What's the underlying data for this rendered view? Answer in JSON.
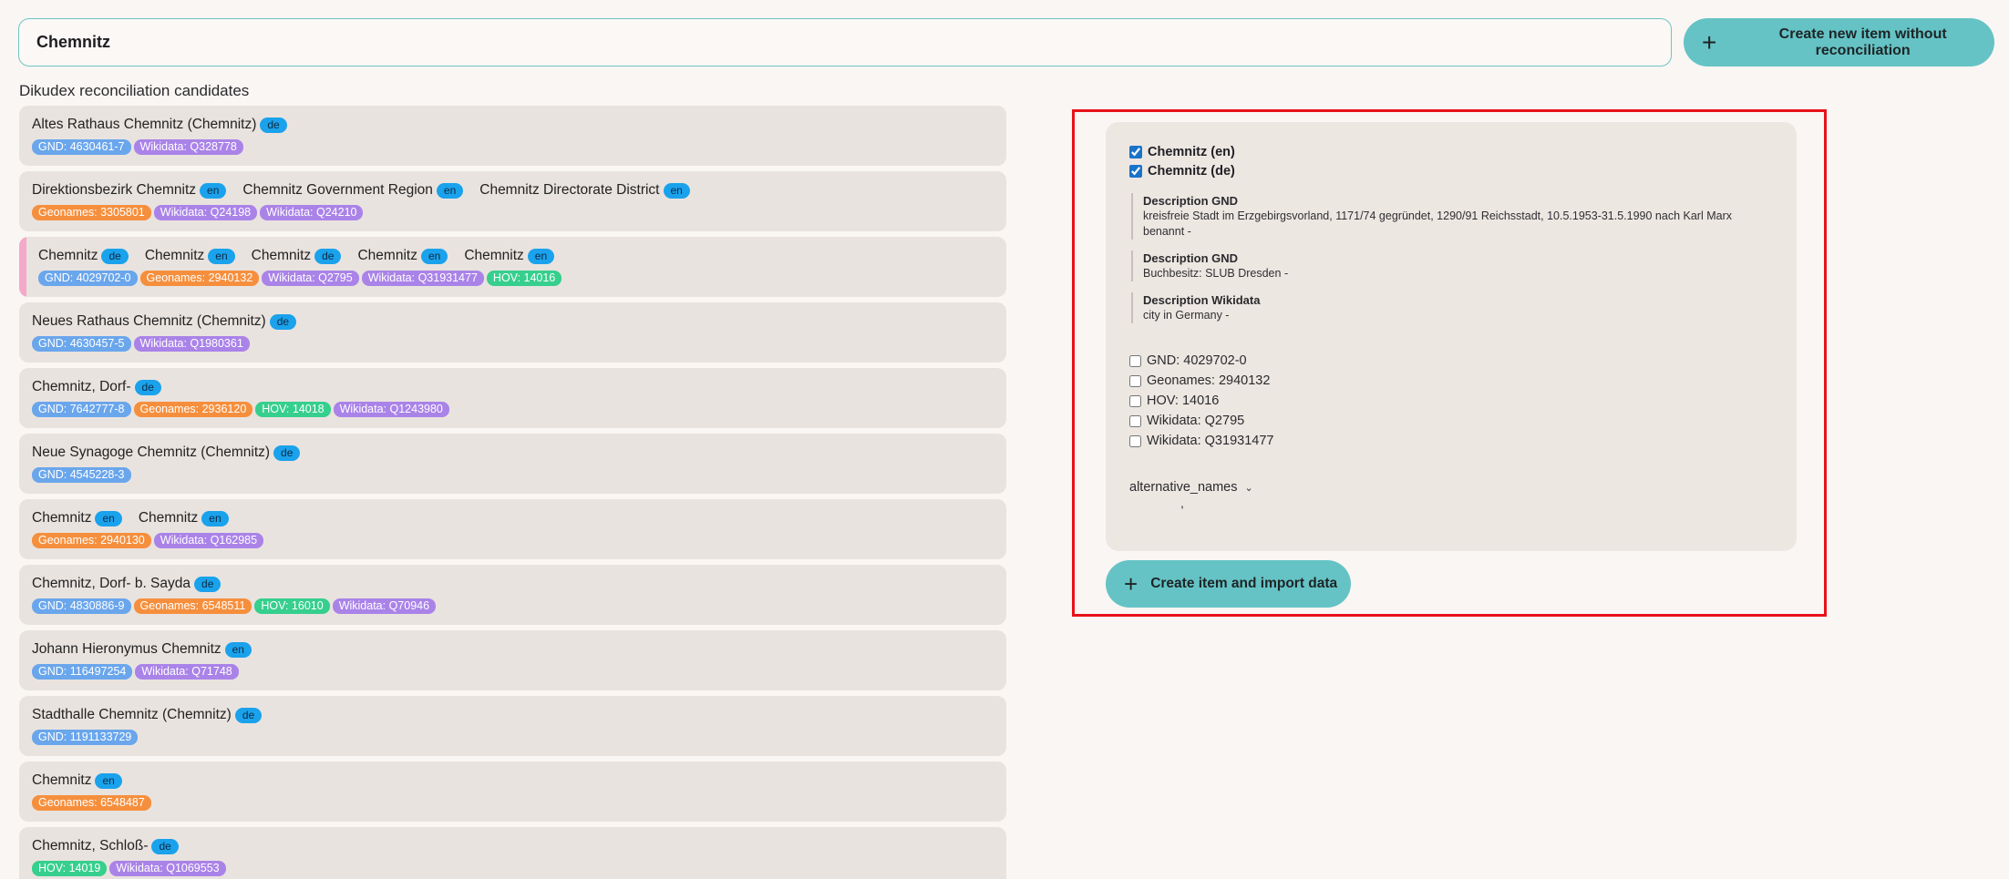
{
  "search": {
    "value": "Chemnitz"
  },
  "create_new_button": {
    "label": "Create new item without reconciliation",
    "icon": "plus-icon"
  },
  "candidates_title": "Dikudex reconciliation candidates",
  "candidates": [
    {
      "names": [
        {
          "text": "Altes Rathaus Chemnitz (Chemnitz)",
          "lang": "de"
        }
      ],
      "ids": [
        {
          "type": "gnd",
          "label": "GND: 4630461-7"
        },
        {
          "type": "wikidata",
          "label": "Wikidata: Q328778"
        }
      ]
    },
    {
      "names": [
        {
          "text": "Direktionsbezirk Chemnitz",
          "lang": "en"
        },
        {
          "text": "Chemnitz Government Region",
          "lang": "en"
        },
        {
          "text": "Chemnitz Directorate District",
          "lang": "en"
        }
      ],
      "ids": [
        {
          "type": "geonames",
          "label": "Geonames: 3305801"
        },
        {
          "type": "wikidata",
          "label": "Wikidata: Q24198"
        },
        {
          "type": "wikidata",
          "label": "Wikidata: Q24210"
        }
      ]
    },
    {
      "selected": true,
      "names": [
        {
          "text": "Chemnitz",
          "lang": "de"
        },
        {
          "text": "Chemnitz",
          "lang": "en"
        },
        {
          "text": "Chemnitz",
          "lang": "de"
        },
        {
          "text": "Chemnitz",
          "lang": "en"
        },
        {
          "text": "Chemnitz",
          "lang": "en"
        }
      ],
      "ids": [
        {
          "type": "gnd",
          "label": "GND: 4029702-0"
        },
        {
          "type": "geonames",
          "label": "Geonames: 2940132"
        },
        {
          "type": "wikidata",
          "label": "Wikidata: Q2795"
        },
        {
          "type": "wikidata",
          "label": "Wikidata: Q31931477"
        },
        {
          "type": "hov",
          "label": "HOV: 14016"
        }
      ]
    },
    {
      "names": [
        {
          "text": "Neues Rathaus Chemnitz (Chemnitz)",
          "lang": "de"
        }
      ],
      "ids": [
        {
          "type": "gnd",
          "label": "GND: 4630457-5"
        },
        {
          "type": "wikidata",
          "label": "Wikidata: Q1980361"
        }
      ]
    },
    {
      "names": [
        {
          "text": "Chemnitz, Dorf-",
          "lang": "de"
        }
      ],
      "ids": [
        {
          "type": "gnd",
          "label": "GND: 7642777-8"
        },
        {
          "type": "geonames",
          "label": "Geonames: 2936120"
        },
        {
          "type": "hov",
          "label": "HOV: 14018"
        },
        {
          "type": "wikidata",
          "label": "Wikidata: Q1243980"
        }
      ]
    },
    {
      "names": [
        {
          "text": "Neue Synagoge Chemnitz (Chemnitz)",
          "lang": "de"
        }
      ],
      "ids": [
        {
          "type": "gnd",
          "label": "GND: 4545228-3"
        }
      ]
    },
    {
      "names": [
        {
          "text": "Chemnitz",
          "lang": "en"
        },
        {
          "text": "Chemnitz",
          "lang": "en"
        }
      ],
      "ids": [
        {
          "type": "geonames",
          "label": "Geonames: 2940130"
        },
        {
          "type": "wikidata",
          "label": "Wikidata: Q162985"
        }
      ]
    },
    {
      "names": [
        {
          "text": "Chemnitz, Dorf- b. Sayda",
          "lang": "de"
        }
      ],
      "ids": [
        {
          "type": "gnd",
          "label": "GND: 4830886-9"
        },
        {
          "type": "geonames",
          "label": "Geonames: 6548511"
        },
        {
          "type": "hov",
          "label": "HOV: 16010"
        },
        {
          "type": "wikidata",
          "label": "Wikidata: Q70946"
        }
      ]
    },
    {
      "names": [
        {
          "text": "Johann Hieronymus Chemnitz",
          "lang": "en"
        }
      ],
      "ids": [
        {
          "type": "gnd",
          "label": "GND: 116497254"
        },
        {
          "type": "wikidata",
          "label": "Wikidata: Q71748"
        }
      ]
    },
    {
      "names": [
        {
          "text": "Stadthalle Chemnitz (Chemnitz)",
          "lang": "de"
        }
      ],
      "ids": [
        {
          "type": "gnd",
          "label": "GND: 1191133729"
        }
      ]
    },
    {
      "names": [
        {
          "text": "Chemnitz",
          "lang": "en"
        }
      ],
      "ids": [
        {
          "type": "geonames",
          "label": "Geonames: 6548487"
        }
      ]
    },
    {
      "names": [
        {
          "text": "Chemnitz, Schloß-",
          "lang": "de"
        }
      ],
      "ids": [
        {
          "type": "hov",
          "label": "HOV: 14019"
        },
        {
          "type": "wikidata",
          "label": "Wikidata: Q1069553"
        }
      ]
    }
  ],
  "detail": {
    "name_options": [
      {
        "label": "Chemnitz (en)",
        "checked": true
      },
      {
        "label": "Chemnitz (de)",
        "checked": true
      }
    ],
    "descriptions": [
      {
        "title": "Description GND",
        "text": "kreisfreie Stadt im Erzgebirgsvorland, 1171/74 gegründet, 1290/91 Reichsstadt, 10.5.1953-31.5.1990 nach Karl Marx benannt -"
      },
      {
        "title": "Description GND",
        "text": "Buchbesitz: SLUB Dresden -"
      },
      {
        "title": "Description Wikidata",
        "text": "city in Germany -"
      }
    ],
    "id_options": [
      {
        "label": "GND: 4029702-0",
        "checked": false
      },
      {
        "label": "Geonames: 2940132",
        "checked": false
      },
      {
        "label": "HOV: 14016",
        "checked": false
      },
      {
        "label": "Wikidata: Q2795",
        "checked": false
      },
      {
        "label": "Wikidata: Q31931477",
        "checked": false
      }
    ],
    "alternative_names_label": "alternative_names",
    "alternative_names_value": ","
  },
  "import_button": {
    "label": "Create item and import data",
    "icon": "plus-icon"
  },
  "colors": {
    "accent": "#65c3c5",
    "gnd": "#6aa6ec",
    "geonames": "#f68f3d",
    "wikidata": "#aa83e8",
    "hov": "#36cf8d",
    "lang": "#1aa2ec",
    "highlight": "#e8121b"
  }
}
